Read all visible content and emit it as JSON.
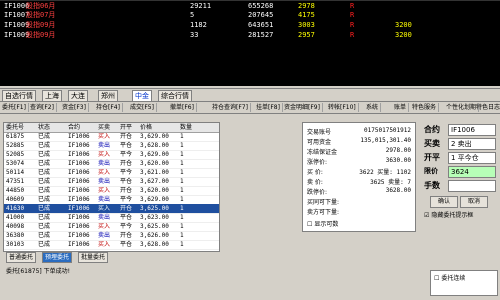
{
  "quote_board": {
    "rows": [
      {
        "code": "IF1006",
        "name": "股指06月",
        "vol": "29211",
        "amt": "655268",
        "px": "2978",
        "flag": "R",
        "ask": ""
      },
      {
        "code": "IF1007",
        "name": "股指07月",
        "vol": "5",
        "amt": "207645",
        "px": "4175",
        "flag": "R",
        "ask": ""
      },
      {
        "code": "IF1009",
        "name": "股指09月",
        "vol": "1182",
        "amt": "643651",
        "px": "3003",
        "flag": "R",
        "ask": "3200"
      },
      {
        "code": "IF1009",
        "name": "股指09月",
        "vol": "33",
        "amt": "281527",
        "px": "2957",
        "flag": "R",
        "ask": "3200"
      },
      {
        "code": "",
        "name": "",
        "vol": "",
        "amt": "",
        "px": "",
        "flag": "",
        "ask": ""
      }
    ],
    "colors": {
      "code": "#ffffff",
      "name": "#ff4040",
      "vol": "#ffffff",
      "amt": "#ffffff",
      "px": "#ffff00",
      "flag": "#ff2020",
      "ask": "#ffff00"
    }
  },
  "tabs": [
    {
      "label": "自选行情",
      "active": false
    },
    {
      "label": "上海",
      "active": false
    },
    {
      "label": "大连",
      "active": false
    },
    {
      "label": "郑州",
      "active": false
    },
    {
      "label": "中金",
      "active": true
    },
    {
      "label": "综合行情",
      "active": false
    }
  ],
  "toolbar": [
    "委托[F1]",
    "查询[F2]",
    "资金[F3]",
    "持仓[F4]",
    "成交[F5]",
    "撤单[F6]",
    "持仓查询[F7]",
    "挂单[F8]",
    "资金明细[F9]",
    "转帐[F10]",
    "系统",
    "账单",
    "特色服务",
    "个性化划期",
    "特色日志"
  ],
  "grid": {
    "headers": [
      "委托号",
      "状态",
      "合约",
      "买卖",
      "开平",
      "价格",
      "数量"
    ],
    "rows": [
      {
        "id": "61875",
        "st": "已成",
        "c": "IF1006",
        "bs": "买入",
        "oc": "开仓",
        "p": "3,629.00",
        "q": "1",
        "sel": false
      },
      {
        "id": "52885",
        "st": "已成",
        "c": "IF1006",
        "bs": "卖出",
        "oc": "平仓",
        "p": "3,628.00",
        "q": "1",
        "sel": false
      },
      {
        "id": "52085",
        "st": "已成",
        "c": "IF1006",
        "bs": "买入",
        "oc": "平今",
        "p": "3,629.00",
        "q": "1",
        "sel": false
      },
      {
        "id": "53074",
        "st": "已成",
        "c": "IF1006",
        "bs": "卖出",
        "oc": "开仓",
        "p": "3,620.00",
        "q": "1",
        "sel": false
      },
      {
        "id": "50114",
        "st": "已成",
        "c": "IF1006",
        "bs": "买入",
        "oc": "平今",
        "p": "3,621.00",
        "q": "1",
        "sel": false
      },
      {
        "id": "47351",
        "st": "已成",
        "c": "IF1006",
        "bs": "卖出",
        "oc": "平仓",
        "p": "3,627.00",
        "q": "1",
        "sel": false
      },
      {
        "id": "44850",
        "st": "已成",
        "c": "IF1006",
        "bs": "买入",
        "oc": "开仓",
        "p": "3,620.00",
        "q": "1",
        "sel": false
      },
      {
        "id": "40609",
        "st": "已成",
        "c": "IF1006",
        "bs": "卖出",
        "oc": "平今",
        "p": "3,629.00",
        "q": "1",
        "sel": false
      },
      {
        "id": "41630",
        "st": "已成",
        "c": "IF1006",
        "bs": "买入",
        "oc": "开仓",
        "p": "3,625.00",
        "q": "1",
        "sel": true
      },
      {
        "id": "41000",
        "st": "已成",
        "c": "IF1006",
        "bs": "卖出",
        "oc": "平仓",
        "p": "3,623.00",
        "q": "1",
        "sel": false
      },
      {
        "id": "40098",
        "st": "已成",
        "c": "IF1006",
        "bs": "买入",
        "oc": "平今",
        "p": "3,625.00",
        "q": "1",
        "sel": false
      },
      {
        "id": "36380",
        "st": "已成",
        "c": "IF1006",
        "bs": "卖出",
        "oc": "开仓",
        "p": "3,626.00",
        "q": "1",
        "sel": false
      },
      {
        "id": "30103",
        "st": "已成",
        "c": "IF1006",
        "bs": "买入",
        "oc": "平仓",
        "p": "3,628.00",
        "q": "1",
        "sel": false
      }
    ]
  },
  "info": {
    "items": [
      {
        "k": "交易账号",
        "v": "0175017501912"
      },
      {
        "k": "可用资金",
        "v": "135,015,301.40"
      },
      {
        "k": "冻结保证金",
        "v": "2978.00"
      },
      {
        "k": "涨停价:",
        "v": "3630.00"
      },
      {
        "k": "买  价:",
        "v": "3622  买量: 1102"
      },
      {
        "k": "卖  价:",
        "v": "3625  卖量: 7"
      },
      {
        "k": "跌停价:",
        "v": "3628.00"
      },
      {
        "k": "买同可下量:",
        "v": ""
      },
      {
        "k": "卖方可下量:",
        "v": ""
      }
    ],
    "checkbox": "显示可数"
  },
  "order_form": {
    "contract_label": "合约",
    "contract_value": "IF1006",
    "side_label": "买卖",
    "side_value": "2 卖出",
    "oc_label": "开平",
    "oc_value": "1 平今仓",
    "price_label": "限价",
    "price_value": "3624",
    "qty_label": "手数",
    "qty_value": "",
    "confirm_btn": "确认",
    "cancel_btn": "取消",
    "hide_checkbox": "隐藏委托提示框"
  },
  "bottom": {
    "tabs": [
      "普通委托",
      "预埋委托",
      "批量委托"
    ],
    "msg": "委托[61875] 下单成功!",
    "right_checkbox": "委托连续"
  }
}
